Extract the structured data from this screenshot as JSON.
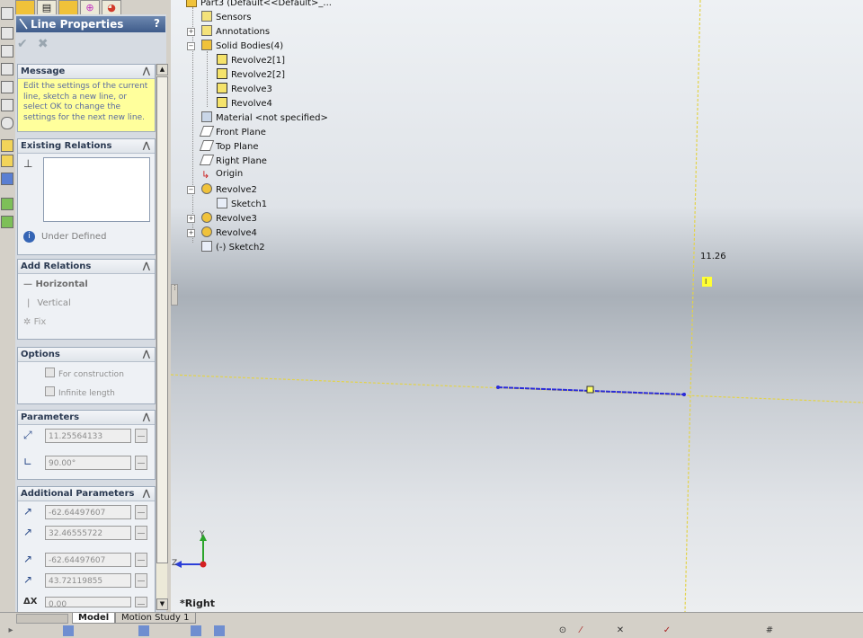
{
  "tree": {
    "part_label": "Part3 (Default<<Default>_...",
    "items": [
      {
        "label": "Sensors"
      },
      {
        "label": "Annotations"
      },
      {
        "label": "Solid Bodies(4)"
      },
      {
        "label": "Revolve2[1]"
      },
      {
        "label": "Revolve2[2]"
      },
      {
        "label": "Revolve3"
      },
      {
        "label": "Revolve4"
      },
      {
        "label": "Material <not specified>"
      },
      {
        "label": "Front Plane"
      },
      {
        "label": "Top Plane"
      },
      {
        "label": "Right Plane"
      },
      {
        "label": "Origin"
      },
      {
        "label": "Revolve2"
      },
      {
        "label": "Sketch1"
      },
      {
        "label": "Revolve3"
      },
      {
        "label": "Revolve4"
      },
      {
        "label": "(-) Sketch2"
      }
    ]
  },
  "pm": {
    "title": "Line Properties",
    "help": "?",
    "ok": "✔",
    "cancel": "✖",
    "message": {
      "header": "Message",
      "text": "Edit the settings of the current line, sketch a new line, or select OK to change the settings for the next new line."
    },
    "existing_relations": {
      "header": "Existing Relations",
      "status": "Under Defined"
    },
    "add_relations": {
      "header": "Add Relations",
      "items": [
        "Horizontal",
        "Vertical",
        "Fix"
      ]
    },
    "options": {
      "header": "Options",
      "for_construction": "For construction",
      "infinite_length": "Infinite length"
    },
    "parameters": {
      "header": "Parameters",
      "length": "11.25564133",
      "angle": "90.00°"
    },
    "additional": {
      "header": "Additional Parameters",
      "start_x": "-62.64497607",
      "start_y": "32.46555722",
      "end_x": "-62.64497607",
      "end_y": "43.72119855",
      "delta_x": "0.00",
      "delta_label": "ΔX"
    }
  },
  "viewport": {
    "dimension": "11.26",
    "view_label": "*Right",
    "triad_y": "Y",
    "triad_z": "Z",
    "line_color": "#2a2ad8",
    "guide_color": "#e8d84a",
    "relation_badge": "I"
  },
  "bottom_tabs": {
    "model": "Model",
    "motion": "Motion Study 1"
  }
}
